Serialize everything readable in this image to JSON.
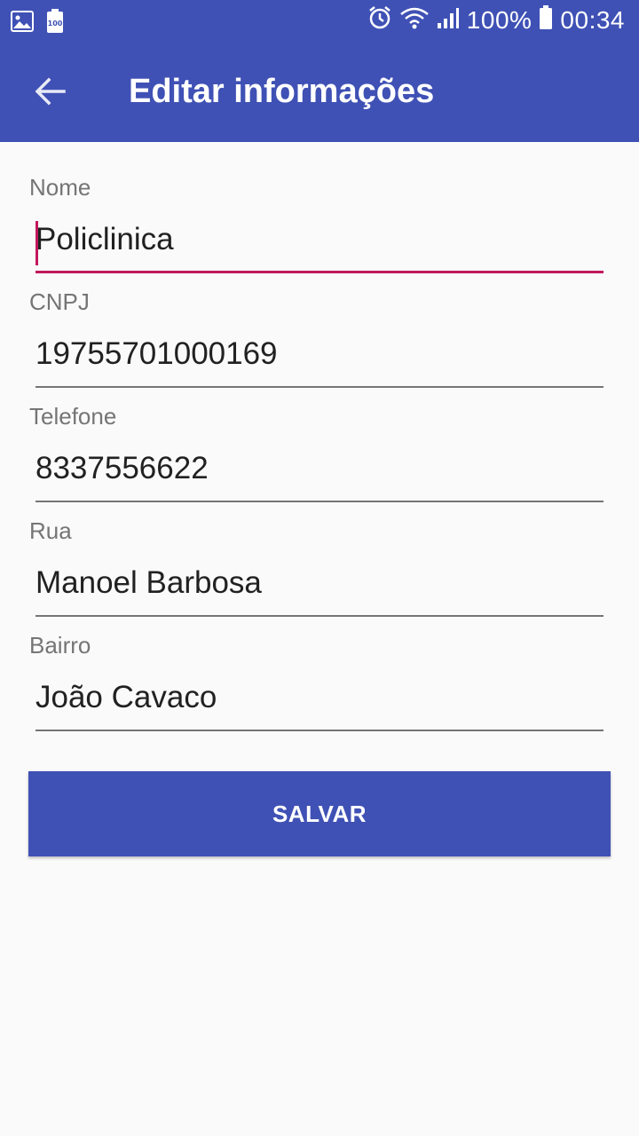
{
  "statusbar": {
    "battery_percent": "100%",
    "time": "00:34",
    "icons": [
      "image-icon",
      "battery-saver-icon",
      "alarm-icon",
      "wifi-icon",
      "signal-icon",
      "battery-icon"
    ]
  },
  "toolbar": {
    "title": "Editar informações",
    "back_icon": "arrow-back-icon"
  },
  "form": {
    "fields": [
      {
        "label": "Nome",
        "value": "Policlinica",
        "focused": true
      },
      {
        "label": "CNPJ",
        "value": "19755701000169",
        "focused": false
      },
      {
        "label": "Telefone",
        "value": "8337556622",
        "focused": false
      },
      {
        "label": "Rua",
        "value": "Manoel Barbosa",
        "focused": false
      },
      {
        "label": "Bairro",
        "value": "João Cavaco",
        "focused": false
      }
    ],
    "save_label": "SALVAR"
  },
  "colors": {
    "primary": "#3f51b5",
    "accent": "#c2185b",
    "background": "#fafafa"
  }
}
